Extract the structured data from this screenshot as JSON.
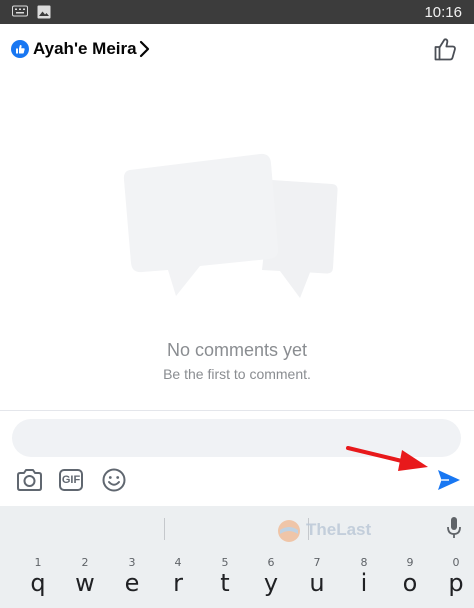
{
  "status_bar": {
    "time": "10:16",
    "icons": [
      "keyboard-icon",
      "image-icon"
    ]
  },
  "header": {
    "title": "Ayah'e Meira",
    "icons": [
      "like-badge-icon",
      "chevron-right-icon",
      "thumbs-up-icon"
    ]
  },
  "empty_state": {
    "title": "No comments yet",
    "subtitle": "Be the first to comment."
  },
  "composer": {
    "placeholder": "",
    "tools": [
      "camera-icon",
      "gif-icon",
      "emoji-icon"
    ],
    "gif_label": "GIF",
    "send_icon": "send-icon"
  },
  "watermark": {
    "text": "TheLast"
  },
  "keyboard": {
    "keys": [
      {
        "num": "1",
        "letter": "q"
      },
      {
        "num": "2",
        "letter": "w"
      },
      {
        "num": "3",
        "letter": "e"
      },
      {
        "num": "4",
        "letter": "r"
      },
      {
        "num": "5",
        "letter": "t"
      },
      {
        "num": "6",
        "letter": "y"
      },
      {
        "num": "7",
        "letter": "u"
      },
      {
        "num": "8",
        "letter": "i"
      },
      {
        "num": "9",
        "letter": "o"
      },
      {
        "num": "0",
        "letter": "p"
      }
    ]
  },
  "colors": {
    "accent": "#1877f2",
    "annotation": "#e8191b",
    "muted_text": "#8a8d91",
    "input_bg": "#f0f2f5"
  }
}
